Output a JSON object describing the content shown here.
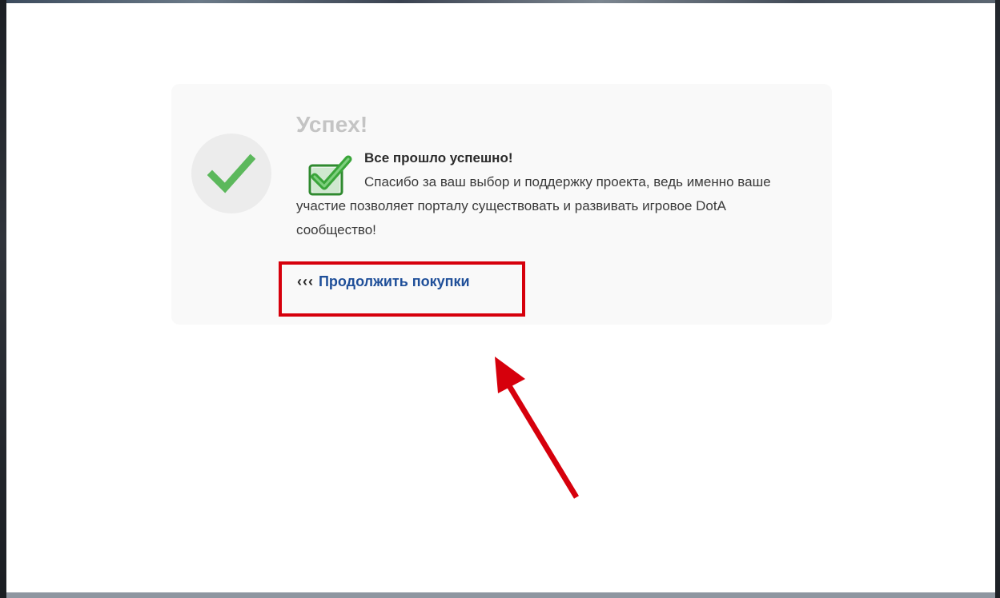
{
  "success_card": {
    "title": "Успех!",
    "subtitle": "Все прошло успешно!",
    "message": "Спасибо за ваш выбор и поддержку проекта, ведь именно ваше участие позволяет порталу существовать и развивать игровое DotA сообщество!",
    "continue_arrows": "‹‹‹",
    "continue_label": "Продолжить покупки"
  },
  "colors": {
    "title": "#c4c4c4",
    "check_green": "#5cb85c",
    "link": "#1f4f99",
    "annotation_red": "#d6000c"
  },
  "icons": {
    "status": "checkmark-icon",
    "inline": "green-check-box-icon",
    "annotation": "red-arrow-annotation"
  }
}
